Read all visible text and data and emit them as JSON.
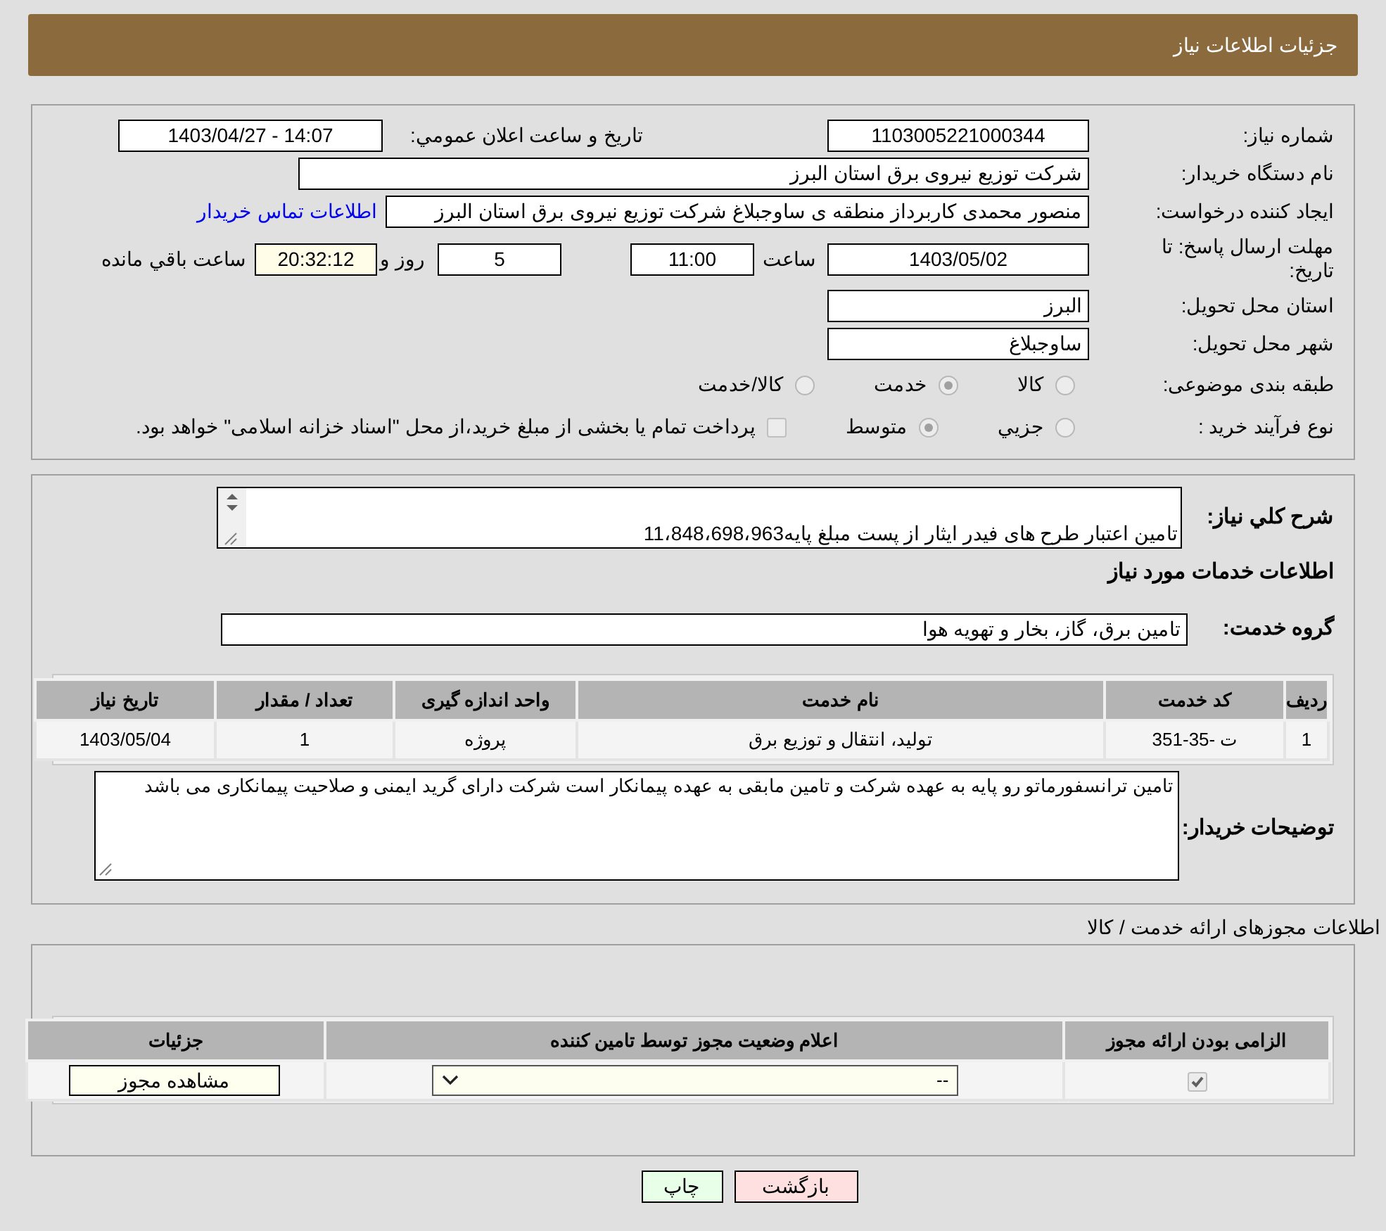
{
  "header": {
    "title": "جزئیات اطلاعات نیاز"
  },
  "need_info": {
    "need_number": {
      "label": "شماره نیاز:",
      "value": "1103005221000344"
    },
    "announce_datetime": {
      "label": "تاریخ و ساعت اعلان عمومي:",
      "value": "1403/04/27 - 14:07"
    },
    "buyer_org": {
      "label": "نام دستگاه خریدار:",
      "value": "شرکت توزیع نیروی برق استان البرز"
    },
    "requester": {
      "label": "ایجاد کننده درخواست:",
      "value": "منصور محمدی کاربرداز منطقه ی ساوجبلاغ شرکت توزیع نیروی برق استان البرز",
      "link": "اطلاعات تماس خریدار"
    },
    "deadline": {
      "label": "مهلت ارسال پاسخ: تا تاریخ:",
      "date": "1403/05/02",
      "time_label": "ساعت",
      "time": "11:00",
      "days": "5",
      "days_label": "روز و",
      "remaining": "20:32:12",
      "remaining_label": "ساعت باقي مانده"
    },
    "province": {
      "label": "استان محل تحویل:",
      "value": "البرز"
    },
    "city": {
      "label": "شهر محل تحویل:",
      "value": "ساوجبلاغ"
    },
    "category": {
      "label": "طبقه بندی موضوعی:",
      "options": [
        {
          "label": "کالا",
          "selected": false
        },
        {
          "label": "خدمت",
          "selected": true
        },
        {
          "label": "کالا/خدمت",
          "selected": false
        }
      ]
    },
    "purchase_process": {
      "label": "نوع فرآیند خرید :",
      "options": [
        {
          "label": "جزیي",
          "selected": false
        },
        {
          "label": "متوسط",
          "selected": true
        }
      ],
      "treasury": {
        "checked": false,
        "text": "پرداخت تمام یا بخشی از مبلغ خرید،از محل \"اسناد خزانه اسلامی\" خواهد بود."
      }
    }
  },
  "services": {
    "description": {
      "label": "شرح کلي نیاز:",
      "value": "تامین اعتبار طرح های فیدر ایثار از پست مبلغ پایه11،848،698،963"
    },
    "heading": "اطلاعات خدمات مورد نیاز",
    "service_group": {
      "label": "گروه خدمت:",
      "value": "تامین برق، گاز، بخار و تهویه هوا"
    },
    "table": {
      "columns": [
        "ردیف",
        "کد خدمت",
        "نام خدمت",
        "واحد اندازه گیری",
        "تعداد / مقدار",
        "تاریخ نیاز"
      ],
      "rows": [
        [
          "1",
          "ت -35-351",
          "تولید، انتقال و توزیع برق",
          "پروژه",
          "1",
          "1403/05/04"
        ]
      ]
    },
    "buyer_notes": {
      "label": "توضیحات خریدار:",
      "value": "تامین ترانسفورماتو رو پایه به عهده شرکت و تامین مابقی به عهده پیمانکار است شرکت دارای گرید ایمنی و صلاحیت پیمانکاری می باشد"
    }
  },
  "licenses": {
    "heading": "اطلاعات مجوزهای ارائه خدمت / کالا",
    "columns": [
      "الزامی بودن ارائه مجوز",
      "اعلام وضعیت مجوز توسط تامین کننده",
      "جزئیات"
    ],
    "rows": [
      {
        "required": true,
        "status": "--",
        "button": "مشاهده مجوز"
      }
    ]
  },
  "buttons": [
    {
      "label": "بازگشت",
      "kind": "back"
    },
    {
      "label": "چاپ",
      "kind": "print"
    }
  ]
}
